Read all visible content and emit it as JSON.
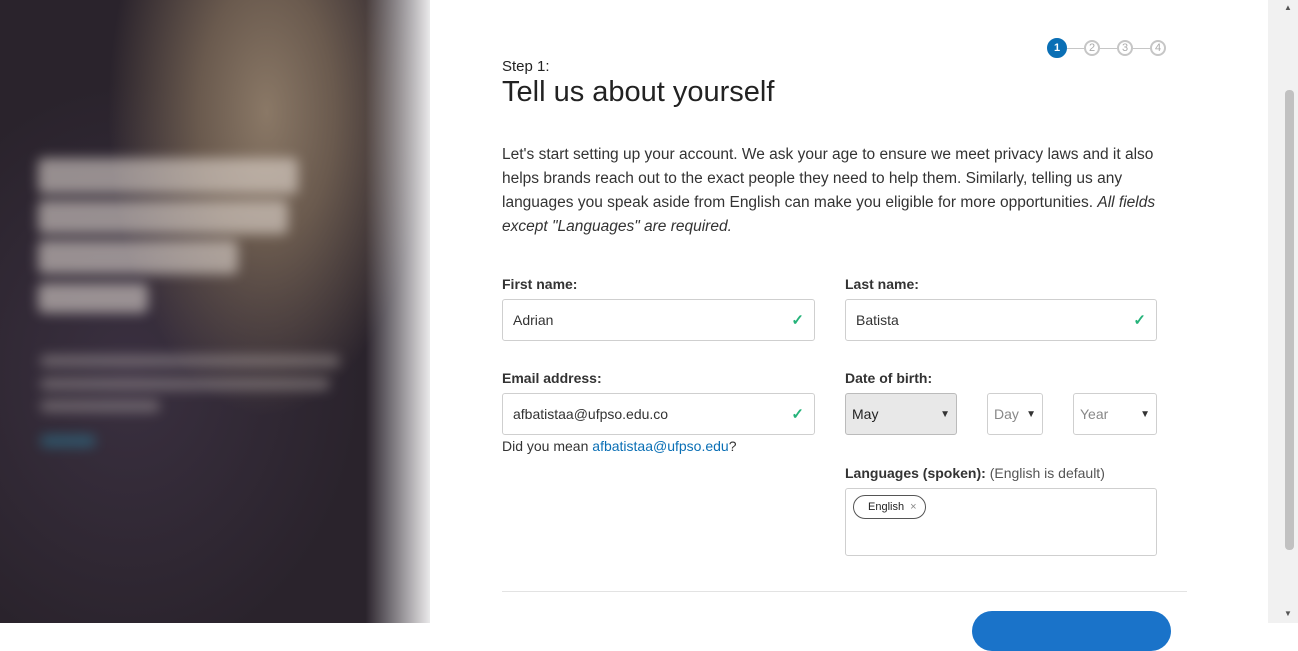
{
  "progress": {
    "steps": [
      "1",
      "2",
      "3",
      "4"
    ],
    "current": 1
  },
  "header": {
    "step_label": "Step 1:",
    "title": "Tell us about yourself"
  },
  "intro": {
    "text": "Let's start setting up your account. We ask your age to ensure we meet privacy laws and it also helps brands reach out to the exact people they need to help them. Similarly, telling us any languages you speak aside from English can make you eligible for more opportunities. ",
    "emphasis": "All fields except \"Languages\" are required."
  },
  "form": {
    "first_name": {
      "label": "First name:",
      "value": "Adrian"
    },
    "last_name": {
      "label": "Last name:",
      "value": "Batista"
    },
    "email": {
      "label": "Email address:",
      "value": "afbatistaa@ufpso.edu.co"
    },
    "email_suggestion": {
      "prefix": "Did you mean ",
      "suggestion": "afbatistaa@ufpso.edu",
      "suffix": "?"
    },
    "dob": {
      "label": "Date of birth:",
      "month": "May",
      "day": "Day",
      "year": "Year"
    },
    "languages": {
      "label": "Languages (spoken):",
      "hint": "(English is default)",
      "tags": [
        "English"
      ]
    }
  },
  "icons": {
    "check": "check-icon",
    "chevron": "chevron-down-icon",
    "remove": "close-icon"
  },
  "colors": {
    "accent": "#0a6fb5",
    "valid": "#25b37a",
    "button": "#1a73c9"
  }
}
